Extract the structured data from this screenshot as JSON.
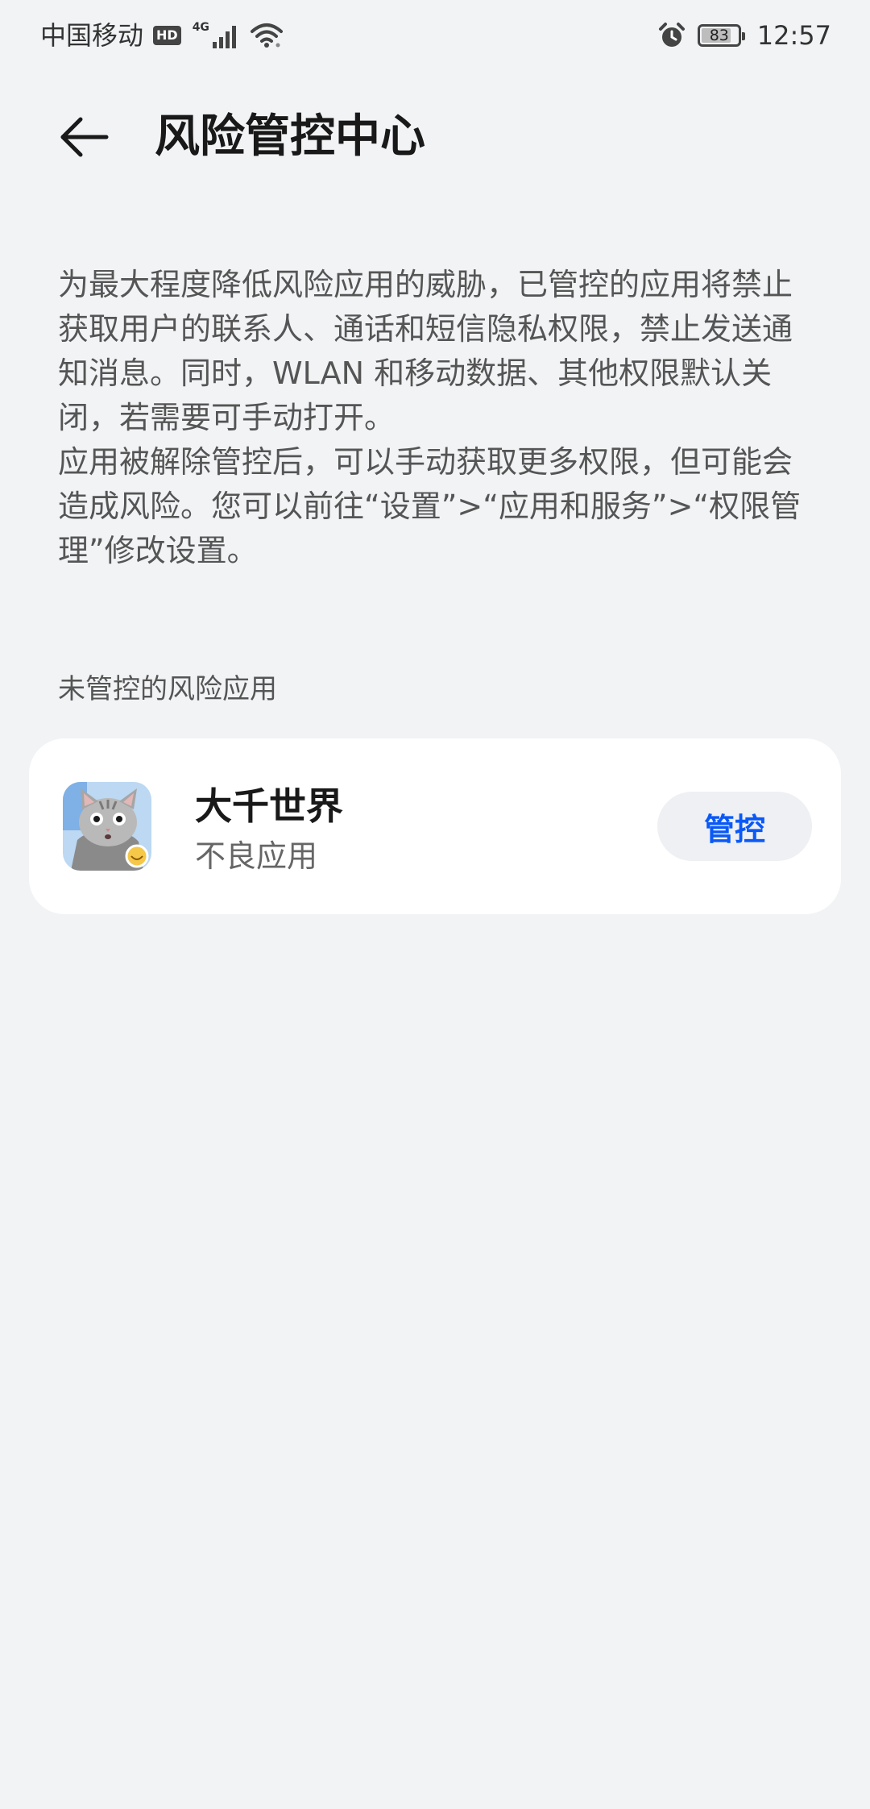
{
  "status_bar": {
    "carrier": "中国移动",
    "hd_badge": "HD",
    "network_type": "4G",
    "battery_level": "83",
    "battery_fraction": 0.83,
    "time": "12:57",
    "icons": [
      "hd-icon",
      "signal-icon",
      "wifi-icon",
      "alarm-icon",
      "battery-icon"
    ]
  },
  "header": {
    "title": "风险管控中心",
    "back_icon": "back-arrow-icon"
  },
  "description": {
    "paragraph_1": "为最大程度降低风险应用的威胁，已管控的应用将禁止获取用户的联系人、通话和短信隐私权限，禁止发送通知消息。同时，WLAN 和移动数据、其他权限默认关闭，若需要可手动打开。",
    "paragraph_2": "应用被解除管控后，可以手动获取更多权限，但可能会造成风险。您可以前往“设置”>“应用和服务”>“权限管理”修改设置。"
  },
  "section": {
    "label": "未管控的风险应用",
    "apps": [
      {
        "name": "大千世界",
        "subtitle": "不良应用",
        "icon": "cat-app-icon",
        "action_label": "管控"
      }
    ]
  },
  "colors": {
    "background": "#f1f3f5",
    "card": "#ffffff",
    "accent": "#0a59f7",
    "button_bg": "#eef0f3"
  }
}
